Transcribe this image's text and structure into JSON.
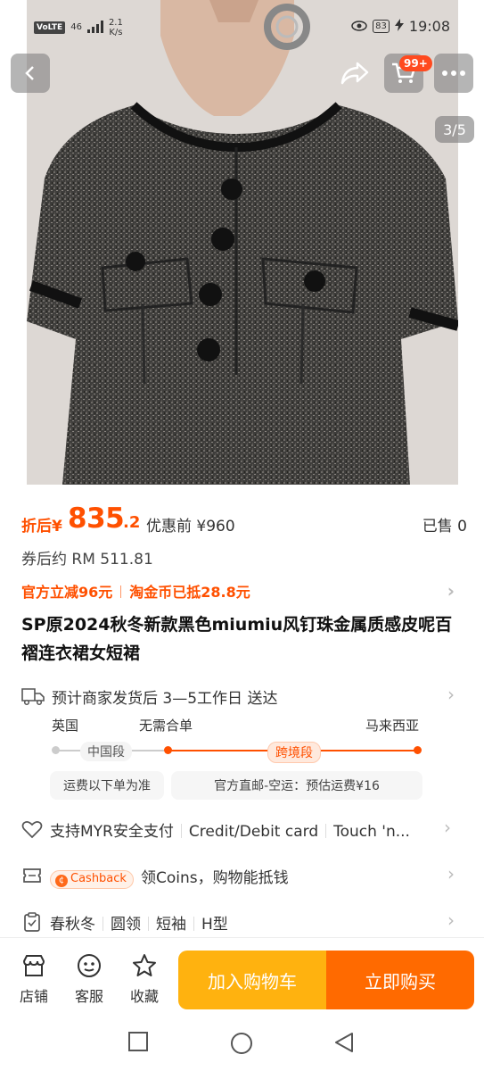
{
  "status_bar": {
    "volte": "VoLTE",
    "signal": "46",
    "net_speed_value": "2.1",
    "net_speed_unit": "K/s",
    "battery": "83",
    "time": "19:08"
  },
  "header": {
    "cart_badge": "99+",
    "image_counter": "3/5"
  },
  "price": {
    "prefix": "折后",
    "currency": "¥",
    "integer": "835",
    "decimal": ".2",
    "original_label": "优惠前",
    "original_price": "¥960",
    "sold": "已售 0"
  },
  "coupon_price": "券后约 RM 511.81",
  "promo": {
    "item1": "官方立减96元",
    "item2": "淘金币已抵28.8元"
  },
  "title": "SP原2024秋冬新款黑色miumiu风钉珠金属质感皮呢百褶连衣裙女短裙",
  "shipping": {
    "headline": "预计商家发货后 3—5工作日 送达",
    "from": "英国",
    "middle": "无需合单",
    "to": "马来西亚",
    "segment_domestic": "中国段",
    "segment_cross": "跨境段",
    "note_left": "运费以下单为准",
    "note_right": "官方直邮-空运：预估运费¥16"
  },
  "payment": {
    "label": "支持MYR安全支付",
    "method1": "Credit/Debit card",
    "method2": "Touch 'n..."
  },
  "cashback": {
    "badge": "Cashback",
    "text": "领Coins，购物能抵钱"
  },
  "attributes": [
    "春秋冬",
    "圆领",
    "短袖",
    "H型"
  ],
  "bottom_bar": {
    "store": "店铺",
    "service": "客服",
    "favorite": "收藏",
    "add_to_cart": "加入购物车",
    "buy_now": "立即购买"
  },
  "colors": {
    "accent": "#ff5000",
    "cart_button": "#ffb20f",
    "buy_button": "#ff6a00"
  }
}
